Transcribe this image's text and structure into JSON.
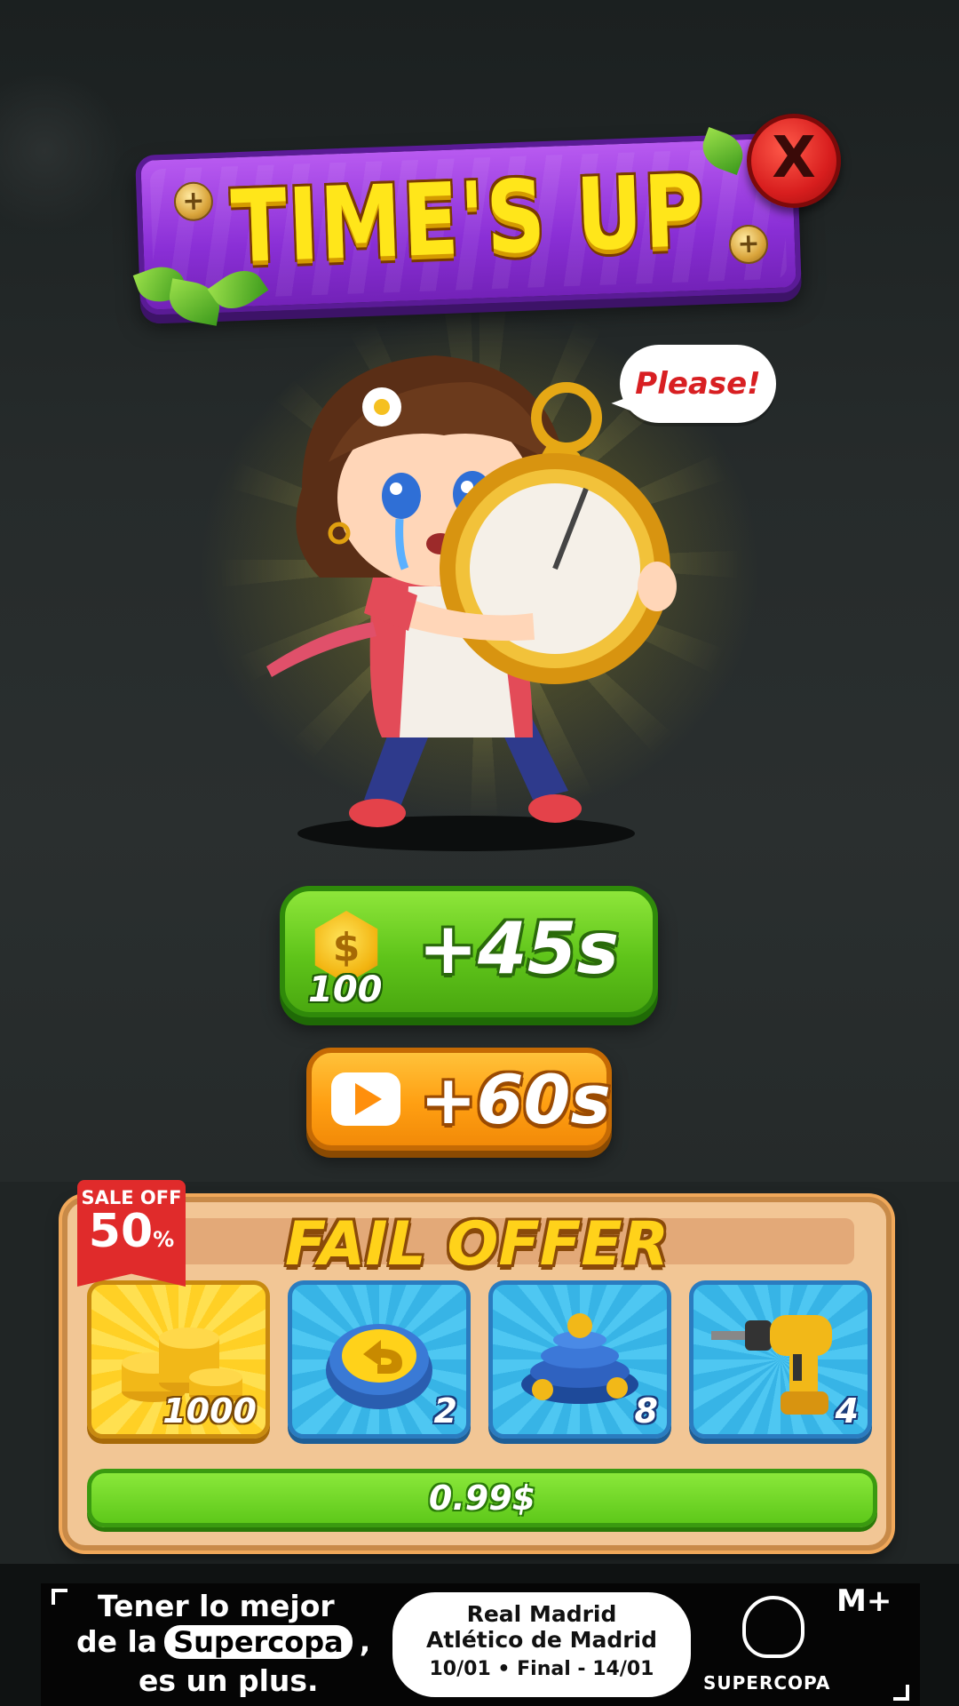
{
  "dialog": {
    "title": "TIME'S UP",
    "close_label": "X",
    "speech_bubble": "Please!"
  },
  "continue_options": {
    "coins_button": {
      "coin_symbol": "$",
      "coin_cost": "100",
      "label": "+45s",
      "icon": "coin-icon"
    },
    "video_button": {
      "label": "+60s",
      "icon": "play-video-icon"
    }
  },
  "fail_offer": {
    "title": "FAIL OFFER",
    "sale_tag": {
      "line1": "SALE OFF",
      "percent": "50",
      "percent_sign": "%"
    },
    "items": [
      {
        "icon": "coin-stack-icon",
        "count": "1000"
      },
      {
        "icon": "undo-icon",
        "count": "2"
      },
      {
        "icon": "screw-pile-icon",
        "count": "8"
      },
      {
        "icon": "drill-icon",
        "count": "4"
      }
    ],
    "price": "0.99$"
  },
  "ad_banner": {
    "line1": "Tener lo mejor",
    "line2_prefix": "de la",
    "line2_highlight": "Supercopa",
    "line2_suffix": ",",
    "line3": "es un plus.",
    "match_team1": "Real Madrid",
    "match_team2": "Atlético de Madrid",
    "match_dates": "10/01  •  Final - 14/01",
    "brand": "M+",
    "competition": "SUPERCOPA"
  },
  "colors": {
    "title_banner": "#8a2fd6",
    "close_button": "#d81e1e",
    "coin_button": "#5fc41a",
    "video_button": "#ff9f12",
    "offer_panel": "#f2c695",
    "price_button": "#5ec81a"
  }
}
